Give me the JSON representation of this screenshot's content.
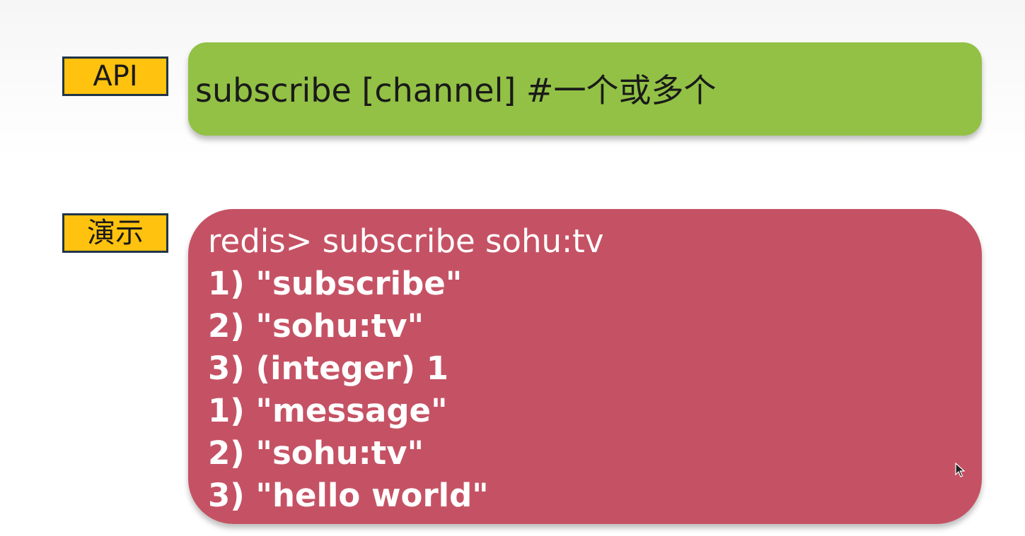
{
  "labels": {
    "api": "API",
    "demo": "演示"
  },
  "api_panel": {
    "command": "subscribe [channel] #一个或多个"
  },
  "demo_panel": {
    "lines": [
      "redis> subscribe sohu:tv",
      "1) \"subscribe\"",
      "2) \"sohu:tv\"",
      "3) (integer) 1",
      "1) \"message\"",
      "2) \"sohu:tv\"",
      "3) \"hello world\""
    ]
  },
  "colors": {
    "label_fill": "#ffc20e",
    "label_border": "#1f3548",
    "api_panel": "#92c145",
    "demo_panel": "#c55264"
  },
  "icons": {
    "cursor": "mouse-pointer-icon"
  }
}
